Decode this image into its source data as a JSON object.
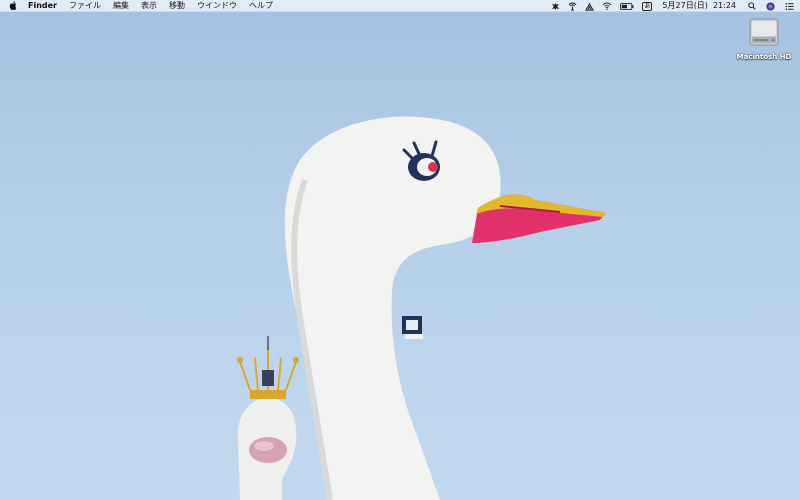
{
  "menubar": {
    "apple_icon": "apple-logo-icon",
    "app_name": "Finder",
    "menus": [
      "ファイル",
      "編集",
      "表示",
      "移動",
      "ウインドウ",
      "ヘルプ"
    ],
    "status_icons": [
      "bug-icon",
      "airdrop-icon",
      "wifi-signal-icon",
      "wifi-icon",
      "battery-icon",
      "input-source-icon"
    ],
    "input_source_label": "あ",
    "date": "5月27日(日)",
    "time": "21:24",
    "right_icons": [
      "spotlight-search-icon",
      "siri-icon",
      "notification-center-icon"
    ]
  },
  "desktop": {
    "drive_label": "Macintosh HD",
    "drive_icon": "hard-drive-icon",
    "wallpaper": "white swan boats against blue sky"
  },
  "colors": {
    "sky": "#b2cde8",
    "menubar_bg": "#ecf1f8",
    "beak_pink": "#e0305f",
    "beak_gold": "#e3b92c"
  }
}
